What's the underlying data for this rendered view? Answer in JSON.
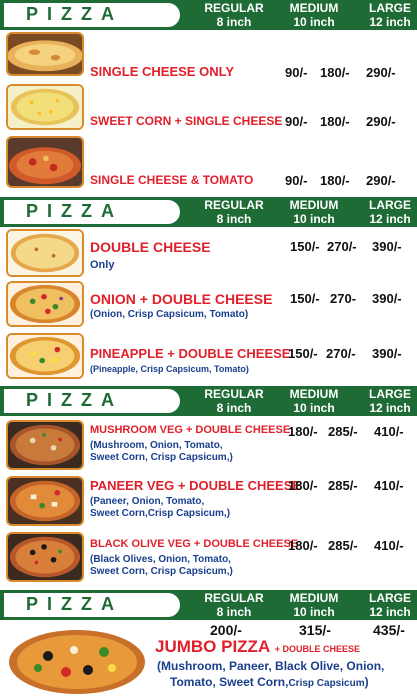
{
  "headers": [
    {
      "title": "PIZZA",
      "regular": "REGULAR",
      "regular_size": "8 inch",
      "medium": "MEDIUM",
      "medium_size": "10 inch",
      "large": "LARGE",
      "large_size": "12 inch"
    },
    {
      "title": "PIZZA",
      "regular": "REGULAR",
      "regular_size": "8 inch",
      "medium": "MEDIUM",
      "medium_size": "10 inch",
      "large": "LARGE",
      "large_size": "12 inch"
    },
    {
      "title": "PIZZA",
      "regular": "REGULAR",
      "regular_size": "8 inch",
      "medium": "MEDIUM",
      "medium_size": "10 inch",
      "large": "LARGE",
      "large_size": "12 inch"
    },
    {
      "title": "PIZZA",
      "regular": "REGULAR",
      "regular_size": "8 inch",
      "medium": "MEDIUM",
      "medium_size": "10 inch",
      "large": "LARGE",
      "large_size": "12 inch"
    }
  ],
  "items": [
    {
      "name": "SINGLE CHEESE ONLY",
      "desc": "",
      "regular": "90/-",
      "medium": "180/-",
      "large": "290/-"
    },
    {
      "name": "SWEET CORN + SINGLE CHEESE",
      "desc": "",
      "regular": "90/-",
      "medium": "180/-",
      "large": "290/-"
    },
    {
      "name": "SINGLE CHEESE & TOMATO",
      "desc": "",
      "regular": "90/-",
      "medium": "180/-",
      "large": "290/-"
    },
    {
      "name": "DOUBLE CHEESE",
      "desc": "Only",
      "regular": "150/-",
      "medium": "270/-",
      "large": "390/-"
    },
    {
      "name": "ONION + DOUBLE CHEESE",
      "desc": "(Onion, Crisp Capsicum, Tomato)",
      "regular": "150/-",
      "medium": "270-",
      "large": "390/-"
    },
    {
      "name": "PINEAPPLE + DOUBLE CHEESE",
      "desc": "(Pineapple, Crisp Capsicum, Tomato)",
      "regular": "150/-",
      "medium": "270/-",
      "large": "390/-"
    },
    {
      "name": "MUSHROOM VEG + DOUBLE CHEESE",
      "desc_lines": [
        "(Mushroom, Onion, Tomato,",
        "Sweet Corn, Crisp Capsicum,)"
      ],
      "regular": "180/-",
      "medium": "285/-",
      "large": "410/-"
    },
    {
      "name": "PANEER VEG + DOUBLE CHEESE",
      "desc_lines": [
        "(Paneer, Onion, Tomato,",
        "Sweet Corn,Crisp Capsicum,)"
      ],
      "regular": "180/-",
      "medium": "285/-",
      "large": "410/-"
    },
    {
      "name": "BLACK OLIVE VEG + DOUBLE CHEESE",
      "desc_lines": [
        "(Black Olives, Onion, Tomato,",
        "Sweet Corn, Crisp Capsicum,)"
      ],
      "regular": "180/-",
      "medium": "285/-",
      "large": "410/-"
    }
  ],
  "jumbo": {
    "name": "JUMBO PIZZA",
    "suffix": "+ DOUBLE CHEESE",
    "regular": "200/-",
    "medium": "315/-",
    "large": "435/-",
    "desc_line1": "(Mushroom,  Paneer, Black Olive, Onion,",
    "desc_line2": "Tomato, Sweet Corn,",
    "desc_line2_small": "Crisp Capsicum",
    "desc_line2_end": ")"
  },
  "colors": {
    "header_green": "#1f6b35",
    "item_red": "#e0202a",
    "desc_blue": "#1a3f8c"
  }
}
